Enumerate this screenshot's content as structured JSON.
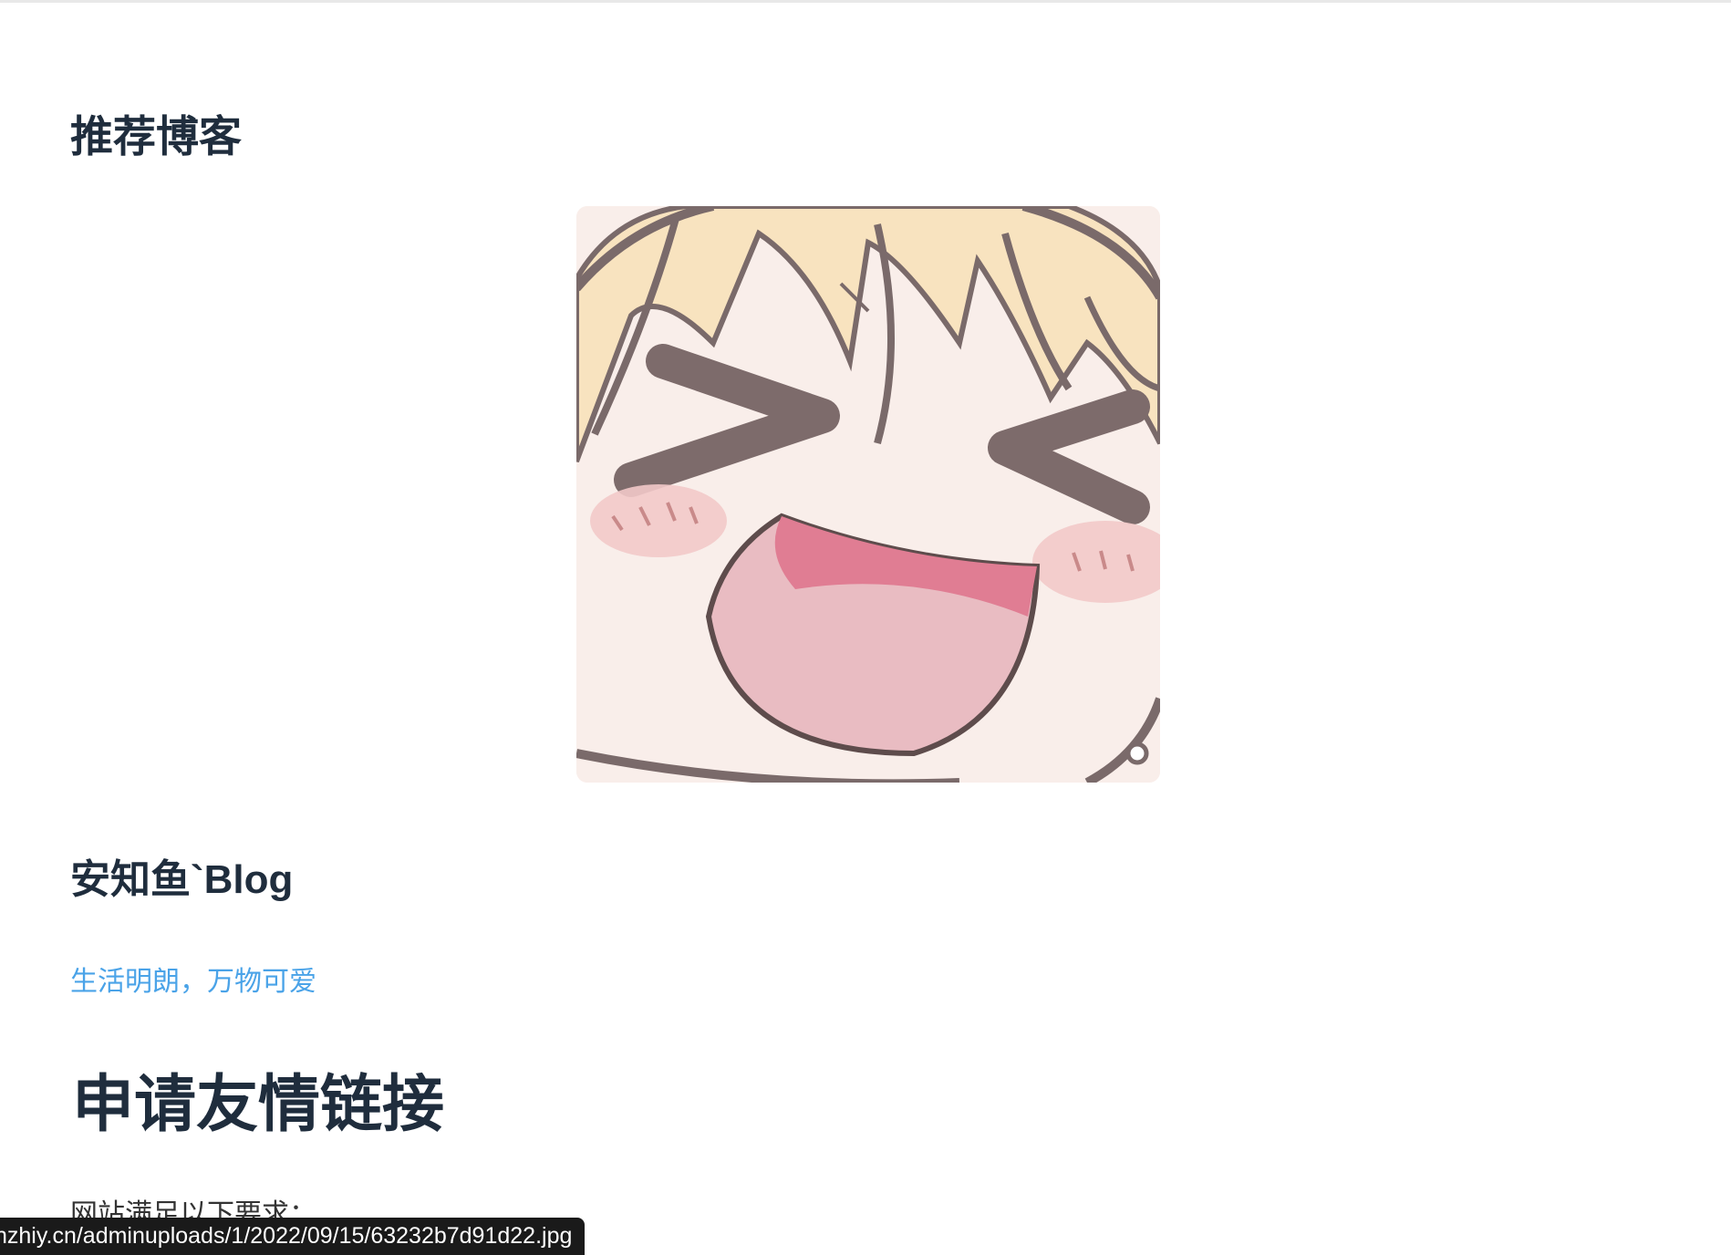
{
  "recommend": {
    "heading": "推荐博客"
  },
  "blog": {
    "image_alt": "anime avatar",
    "name": "安知鱼`Blog",
    "description": "生活明朗，万物可爱"
  },
  "apply": {
    "heading": "申请友情链接",
    "requirements_intro": "网站满足以下要求："
  },
  "status_bar": {
    "url": "nzhiy.cn/adminuploads/1/2022/09/15/63232b7d91d22.jpg"
  },
  "colors": {
    "heading": "#1f2d3d",
    "link": "#4aa3e8",
    "status_bar_bg": "#1a1a1a"
  }
}
